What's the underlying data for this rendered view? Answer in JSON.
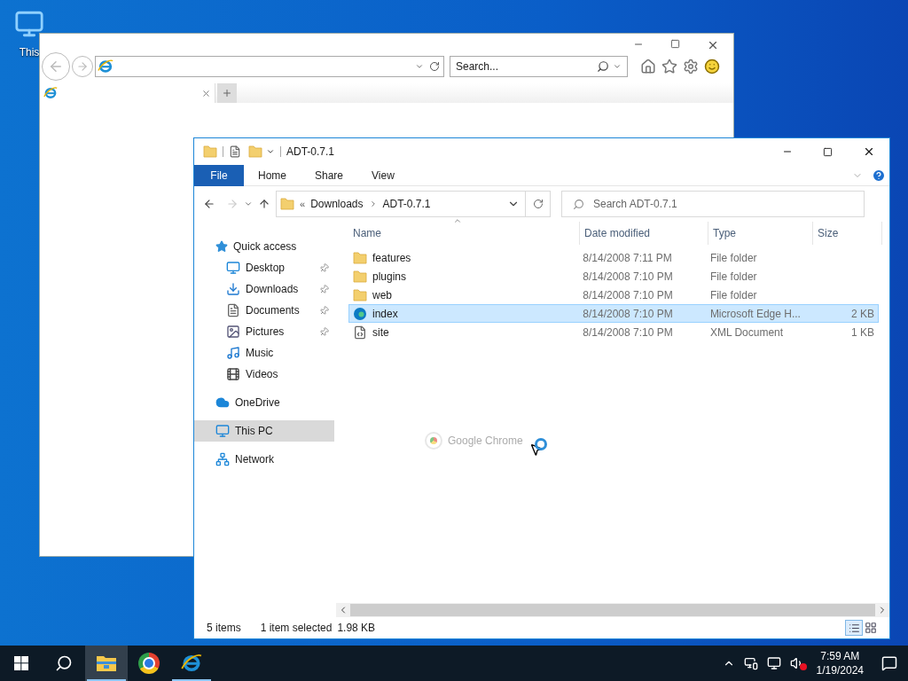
{
  "desktop_icons": [
    {
      "label": "This"
    }
  ],
  "browser_window": {
    "search_placeholder": "Search..."
  },
  "explorer": {
    "title": "ADT-0.7.1",
    "ribbon_tabs": [
      {
        "label": "File",
        "selected": true
      },
      {
        "label": "Home",
        "selected": false
      },
      {
        "label": "Share",
        "selected": false
      },
      {
        "label": "View",
        "selected": false
      }
    ],
    "address": {
      "overflow": "«",
      "path": [
        "Downloads",
        "ADT-0.7.1"
      ]
    },
    "search_placeholder": "Search ADT-0.7.1",
    "sidebar": [
      {
        "label": "Quick access",
        "kind": "star",
        "selected": false,
        "children": [
          {
            "label": "Desktop",
            "kind": "desktop",
            "pinned": true,
            "selected": false
          },
          {
            "label": "Downloads",
            "kind": "download",
            "pinned": true,
            "selected": false
          },
          {
            "label": "Documents",
            "kind": "document",
            "pinned": true,
            "selected": false
          },
          {
            "label": "Pictures",
            "kind": "pictures",
            "pinned": true,
            "selected": false
          },
          {
            "label": "Music",
            "kind": "music",
            "pinned": false,
            "selected": false
          },
          {
            "label": "Videos",
            "kind": "video",
            "pinned": false,
            "selected": false
          }
        ]
      },
      {
        "label": "OneDrive",
        "kind": "cloud",
        "selected": false
      },
      {
        "label": "This PC",
        "kind": "pc",
        "selected": true
      },
      {
        "label": "Network",
        "kind": "network",
        "selected": false
      }
    ],
    "columns": [
      "Name",
      "Date modified",
      "Type",
      "Size"
    ],
    "rows": [
      {
        "name": "features",
        "date": "8/14/2008 7:11 PM",
        "type": "File folder",
        "kind": "folder",
        "selected": false
      },
      {
        "name": "plugins",
        "date": "8/14/2008 7:10 PM",
        "type": "File folder",
        "kind": "folder",
        "selected": false
      },
      {
        "name": "web",
        "date": "8/14/2008 7:10 PM",
        "type": "File folder",
        "kind": "folder",
        "selected": false
      },
      {
        "name": "index",
        "date": "8/14/2008 7:10 PM",
        "type": "Microsoft Edge H...",
        "size": "2 KB",
        "kind": "edge",
        "selected": true
      },
      {
        "name": "site",
        "date": "8/14/2008 7:10 PM",
        "type": "XML Document",
        "size": "1 KB",
        "kind": "xml",
        "selected": false
      }
    ],
    "drag_label": "Google Chrome",
    "status_bar": {
      "count": "5 items",
      "selection": "1 item selected",
      "size": "1.98 KB"
    }
  },
  "taskbar": {
    "apps": [
      {
        "kind": "explorer",
        "running": true,
        "selected": true
      },
      {
        "kind": "chrome",
        "running": false,
        "selected": false
      },
      {
        "kind": "ie",
        "running": true,
        "selected": false
      }
    ],
    "clock": {
      "time": "7:59 AM",
      "date": "1/19/2024"
    }
  }
}
